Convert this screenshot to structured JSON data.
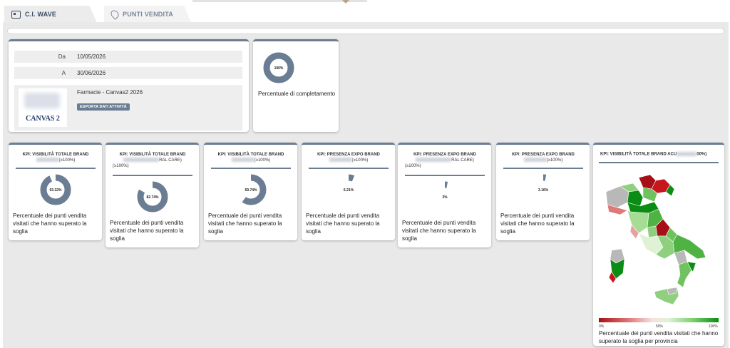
{
  "tabs": [
    {
      "label": "C.I. WAVE",
      "icon": "id-card-icon"
    },
    {
      "label": "PUNTI VENDITA",
      "icon": "location-pin-icon"
    }
  ],
  "dates": {
    "from_label": "Da",
    "from_value": "10/05/2026",
    "to_label": "A",
    "to_value": "30/06/2026"
  },
  "info": {
    "title": "Farmacie - Canvas2 2026",
    "logo_text": "CANVAS 2",
    "export_label": "ESPORTA DATI ATTIVITÀ"
  },
  "completion": {
    "value_label": "100%",
    "value": 1.0,
    "caption": "Percentuale di completamento"
  },
  "kpis": [
    {
      "title": "KPI: VISIBILITÀ TOTALE BRAND",
      "sub": "(≥100%)",
      "value": 93.32,
      "value_label": "93.32%",
      "desc": "Percentuale dei punti vendita visitati che hanno superato la soglia"
    },
    {
      "title": "KPI: VISIBILITÀ TOTALE BRAND",
      "sub": "RAL CARE)",
      "sub2": "(≥100%)",
      "value": 82.74,
      "value_label": "82.74%",
      "desc": "Percentuale dei punti vendita visitati che hanno superato la soglia"
    },
    {
      "title": "KPI: VISIBILITÀ TOTALE BRAND",
      "sub": "(≥100%)",
      "value": 59.74,
      "value_label": "59.74%",
      "desc": "Percentuale dei punti vendita visitati che hanno superato la soglia"
    },
    {
      "title": "KPI: PRESENZA EXPO BRAND",
      "sub": "(≥100%)",
      "value": 6.21,
      "value_label": "6.21%",
      "desc": "Percentuale dei punti vendita visitati che hanno superato la soglia"
    },
    {
      "title": "KPI: PRESENZA EXPO BRAND",
      "sub": "RAL CARE)",
      "sub2": "(≥100%)",
      "value": 3,
      "value_label": "3%",
      "desc": "Percentuale dei punti vendita visitati che hanno superato la soglia"
    },
    {
      "title": "KPI: PRESENZA EXPO BRAND",
      "sub": "(≥100%)",
      "value": 3.16,
      "value_label": "3.16%",
      "desc": "Percentuale dei punti vendita visitati che hanno superato la soglia"
    }
  ],
  "map_card": {
    "title": "KPI: VISIBILITÀ TOTALE BRAND ACU",
    "title_suffix": "00%)",
    "legend_min": "0%",
    "legend_mid": "50%",
    "legend_max": "100%",
    "desc": "Percentuale dei punti vendita visitati che hanno superato la soglia per provincia"
  },
  "colors": {
    "accent": "#6b7d93",
    "donut_track": "#d8dde4",
    "map_red": "#a50f15",
    "map_green": "#0b8c14"
  }
}
